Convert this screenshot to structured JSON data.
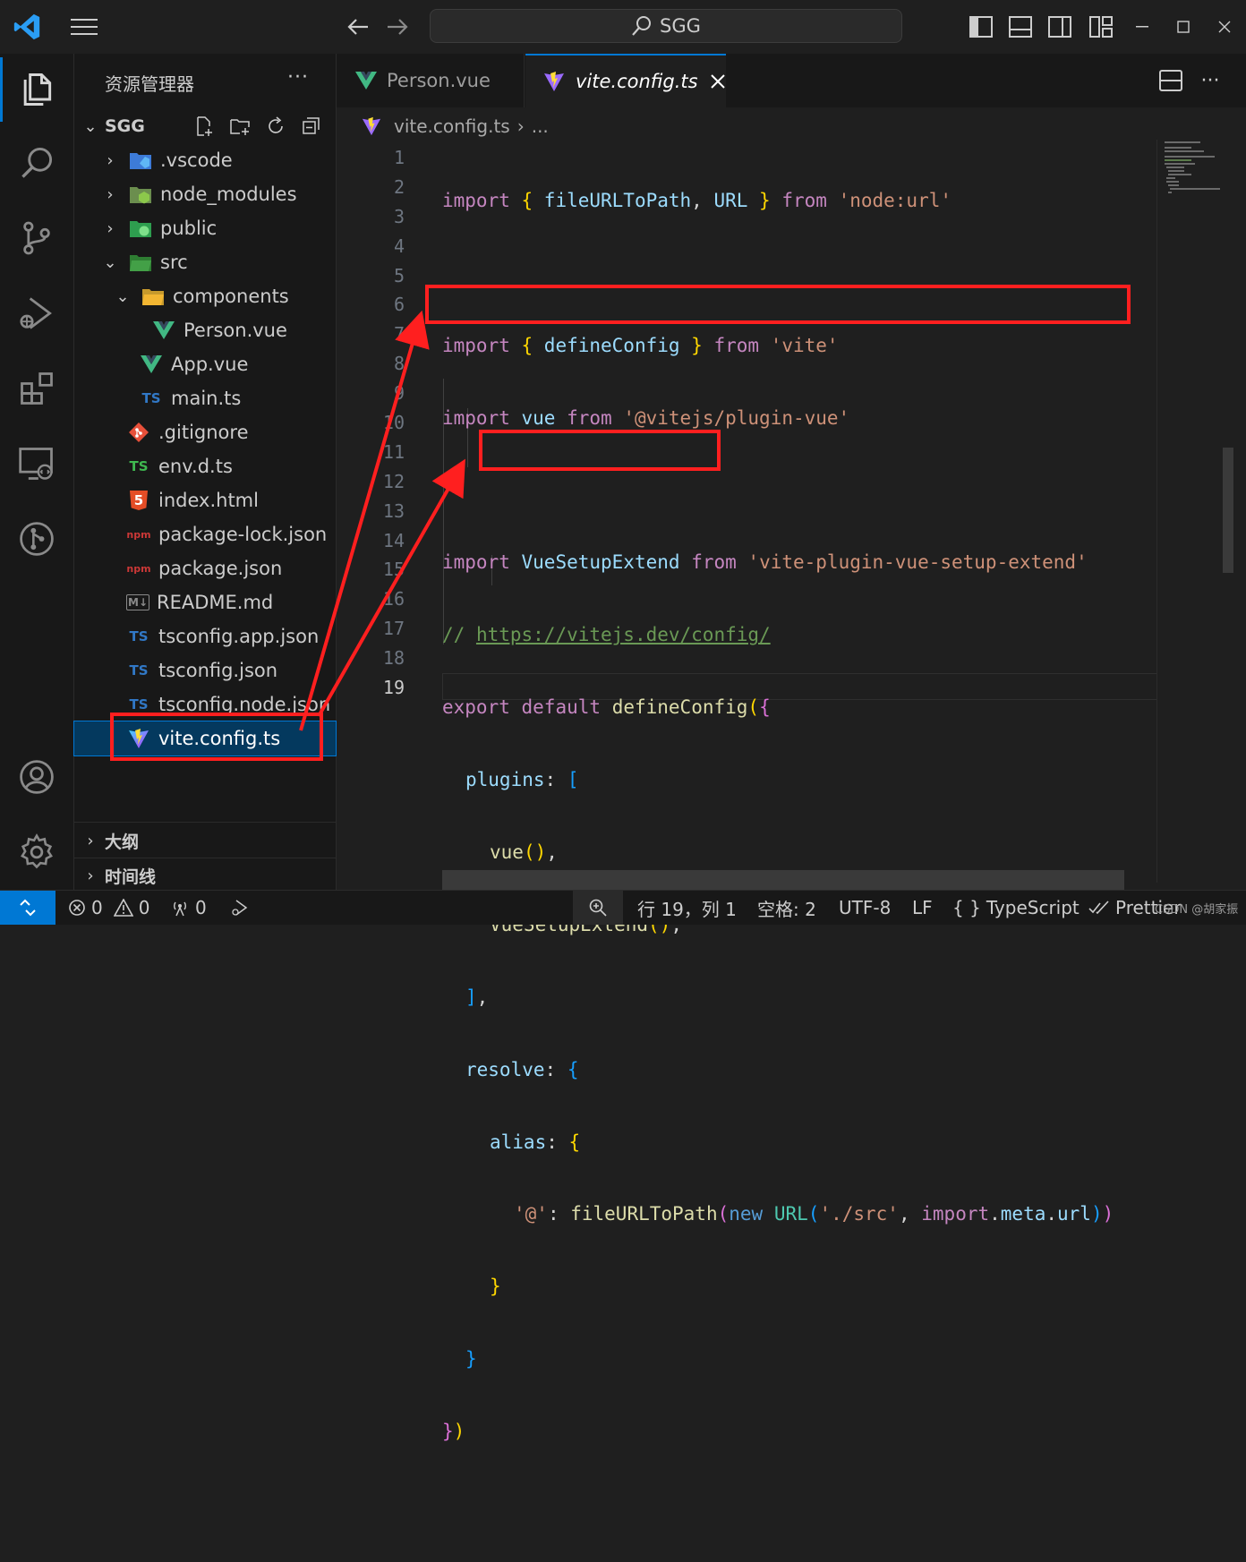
{
  "titlebar": {
    "search_text": "SGG",
    "icons": [
      "vscode-logo-icon",
      "menu-icon",
      "back-arrow-icon",
      "forward-arrow-icon",
      "search-icon",
      "toggle-primary-sidebar-icon",
      "toggle-panel-icon",
      "toggle-secondary-sidebar-icon",
      "customize-layout-icon",
      "minimize-icon",
      "maximize-icon",
      "close-icon"
    ]
  },
  "activity_bar": [
    "explorer-icon",
    "search-icon",
    "source-control-icon",
    "run-debug-icon",
    "extensions-icon",
    "remote-explorer-icon",
    "git-graph-icon",
    "account-icon",
    "settings-gear-icon"
  ],
  "sidebar": {
    "title": "资源管理器",
    "more": "···",
    "root": "SGG",
    "tree": [
      {
        "label": ".vscode",
        "chev": "›",
        "icon": "folder-vscode-icon"
      },
      {
        "label": "node_modules",
        "chev": "›",
        "icon": "folder-node-icon"
      },
      {
        "label": "public",
        "chev": "›",
        "icon": "folder-public-icon"
      },
      {
        "label": "src",
        "chev": "⌄",
        "icon": "folder-src-icon"
      },
      {
        "label": "components",
        "chev": "⌄",
        "icon": "folder-components-icon"
      },
      {
        "label": "Person.vue",
        "chev": "",
        "icon": "vue-file-icon"
      },
      {
        "label": "App.vue",
        "chev": "",
        "icon": "vue-file-icon"
      },
      {
        "label": "main.ts",
        "chev": "",
        "icon": "ts-file-icon",
        "icon_text": "TS"
      },
      {
        "label": ".gitignore",
        "chev": "",
        "icon": "git-file-icon"
      },
      {
        "label": "env.d.ts",
        "chev": "",
        "icon": "ts-file-icon",
        "icon_text": "TS"
      },
      {
        "label": "index.html",
        "chev": "",
        "icon": "html-file-icon",
        "icon_text": "5"
      },
      {
        "label": "package-lock.json",
        "chev": "",
        "icon": "npm-file-icon",
        "icon_text": "npm"
      },
      {
        "label": "package.json",
        "chev": "",
        "icon": "npm-file-icon",
        "icon_text": "npm"
      },
      {
        "label": "README.md",
        "chev": "",
        "icon": "markdown-file-icon",
        "icon_text": "M↓"
      },
      {
        "label": "tsconfig.app.json",
        "chev": "",
        "icon": "tsconfig-file-icon",
        "icon_text": "TS"
      },
      {
        "label": "tsconfig.json",
        "chev": "",
        "icon": "tsconfig-file-icon",
        "icon_text": "TS"
      },
      {
        "label": "tsconfig.node.json",
        "chev": "",
        "icon": "tsconfig-file-icon",
        "icon_text": "TS"
      },
      {
        "label": "vite.config.ts",
        "chev": "",
        "icon": "vite-file-icon"
      }
    ],
    "sections": [
      {
        "label": "大纲"
      },
      {
        "label": "时间线"
      }
    ]
  },
  "tabs": [
    {
      "label": "Person.vue",
      "active": false
    },
    {
      "label": "vite.config.ts",
      "active": true
    }
  ],
  "breadcrumb": {
    "file": "vite.config.ts",
    "sep": "›",
    "more": "..."
  },
  "line_numbers": [
    "1",
    "2",
    "3",
    "4",
    "5",
    "6",
    "7",
    "8",
    "9",
    "10",
    "11",
    "12",
    "13",
    "14",
    "15",
    "16",
    "17",
    "18",
    "19"
  ],
  "code": {
    "l1": [
      "import",
      " { ",
      "fileURLToPath",
      ", ",
      "URL",
      " } ",
      "from",
      " ",
      "'node:url'"
    ],
    "l3": [
      "import",
      " { ",
      "defineConfig",
      " } ",
      "from",
      " ",
      "'vite'"
    ],
    "l4": [
      "import",
      " ",
      "vue",
      " ",
      "from",
      " ",
      "'@vitejs/plugin-vue'"
    ],
    "l6": [
      "import",
      " ",
      "VueSetupExtend",
      " ",
      "from",
      " ",
      "'vite-plugin-vue-setup-extend'"
    ],
    "l7": [
      "// ",
      "https://vitejs.dev/config/"
    ],
    "l8": [
      "export",
      " ",
      "default",
      " ",
      "defineConfig",
      "(",
      "{"
    ],
    "l9": [
      "plugins",
      ": ",
      "["
    ],
    "l10": [
      "vue",
      "()",
      ","
    ],
    "l11": [
      "VueSetupExtend",
      "()",
      ","
    ],
    "l12": [
      "]",
      ","
    ],
    "l13": [
      "resolve",
      ": ",
      "{"
    ],
    "l14": [
      "alias",
      ": ",
      "{"
    ],
    "l15": [
      "'@'",
      ": ",
      "fileURLToPath",
      "(",
      "new",
      " ",
      "URL",
      "(",
      "'./src'",
      ", ",
      "import",
      ".",
      "meta",
      ".",
      "url",
      ")",
      ")"
    ],
    "l16": [
      "}"
    ],
    "l17": [
      "}"
    ],
    "l18": [
      "}",
      ")"
    ]
  },
  "status": {
    "errors": "0",
    "warnings": "0",
    "ports": "0",
    "position": "行 19，列 1",
    "spaces": "空格: 2",
    "encoding": "UTF-8",
    "eol": "LF",
    "language": "TypeScript",
    "language_prefix": "{ }",
    "prettier": "Prettier",
    "watermark": "CSDN @胡家振"
  },
  "colors": {
    "accent": "#0078d4",
    "annotation_red": "#ff1f1f",
    "selection": "#04395e"
  }
}
